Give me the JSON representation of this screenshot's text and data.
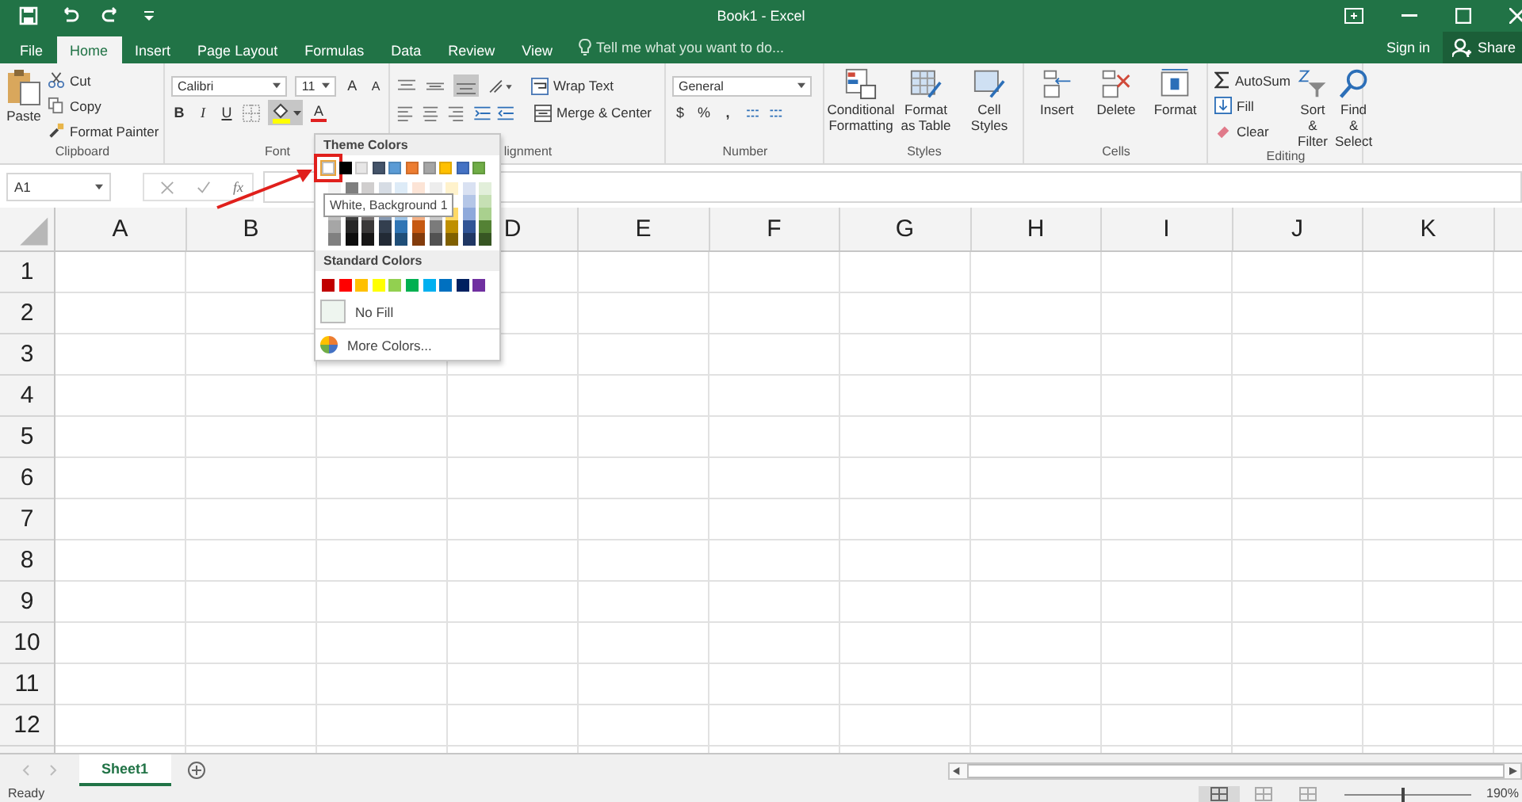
{
  "title_bar": {
    "title": "Book1 - Excel"
  },
  "tabs": [
    {
      "label": "File",
      "selected": false
    },
    {
      "label": "Home",
      "selected": true
    },
    {
      "label": "Insert",
      "selected": false
    },
    {
      "label": "Page Layout",
      "selected": false
    },
    {
      "label": "Formulas",
      "selected": false
    },
    {
      "label": "Data",
      "selected": false
    },
    {
      "label": "Review",
      "selected": false
    },
    {
      "label": "View",
      "selected": false
    }
  ],
  "tell_me": {
    "placeholder": "Tell me what you want to do..."
  },
  "account": {
    "sign_in": "Sign in",
    "share": "Share"
  },
  "ribbon": {
    "clipboard": {
      "label": "Clipboard",
      "paste": "Paste",
      "cut": "Cut",
      "copy": "Copy",
      "format_painter": "Format Painter"
    },
    "font": {
      "label": "Font",
      "font_name": "Calibri",
      "font_size": "11",
      "grow": "A",
      "shrink": "A",
      "bold": "B",
      "italic": "I",
      "underline": "U",
      "font_color": "A"
    },
    "alignment": {
      "label": "lignment",
      "wrap_text": "Wrap Text",
      "merge_center": "Merge & Center"
    },
    "number": {
      "label": "Number",
      "format": "General",
      "currency": "$",
      "percent": "%",
      "comma": ","
    },
    "styles": {
      "label": "Styles",
      "conditional_formatting": "Conditional Formatting",
      "format_as_table": "Format as Table",
      "cell_styles": "Cell Styles"
    },
    "cells": {
      "label": "Cells",
      "insert": "Insert",
      "delete": "Delete",
      "format": "Format"
    },
    "editing": {
      "label": "Editing",
      "autosum": "AutoSum",
      "fill": "Fill",
      "clear": "Clear",
      "sort_filter": "Sort & Filter",
      "find_select": "Find & Select"
    }
  },
  "formula_bar": {
    "name_box": "A1",
    "function_label": "fx"
  },
  "sheet": {
    "columns": [
      "A",
      "B",
      null,
      "D",
      "E",
      "F",
      "G",
      "H",
      "I",
      "J",
      "K"
    ],
    "rows": [
      "1",
      "2",
      "3",
      "4",
      "5",
      "6",
      "7",
      "8",
      "9",
      "10",
      "11",
      "12"
    ]
  },
  "fill_menu": {
    "theme_title": "Theme Colors",
    "theme_colors": [
      {
        "color": "#ffffff",
        "selected": true
      },
      {
        "color": "#000000",
        "selected": false
      },
      {
        "color": "#e7e6e6",
        "selected": false
      },
      {
        "color": "#44546a",
        "selected": false
      },
      {
        "color": "#5b9bd5",
        "selected": false
      },
      {
        "color": "#ed7d31",
        "selected": false
      },
      {
        "color": "#a5a5a5",
        "selected": false
      },
      {
        "color": "#ffc000",
        "selected": false
      },
      {
        "color": "#4472c4",
        "selected": false
      },
      {
        "color": "#70ad47",
        "selected": false
      }
    ],
    "shade_rows": [
      {
        "swatches": [
          {
            "color": "#f2f2f2"
          },
          {
            "color": "#7f7f7f"
          },
          {
            "color": "#d0cece"
          },
          {
            "color": "#d6dce4"
          },
          {
            "color": "#ddebf7"
          },
          {
            "color": "#fce4d6"
          },
          {
            "color": "#ededed"
          },
          {
            "color": "#fff2cc"
          },
          {
            "color": "#d9e1f2"
          },
          {
            "color": "#e2efda"
          }
        ]
      },
      {
        "swatches": [
          {
            "color": "#b4c6e7"
          },
          {
            "color": "#c6e0b4"
          }
        ]
      },
      {
        "swatches": [
          {
            "color": "#bfbfbf"
          },
          {
            "color": "#404040"
          },
          {
            "color": "#757171"
          },
          {
            "color": "#8497b0"
          },
          {
            "color": "#9bc2e6"
          },
          {
            "color": "#f4b084"
          },
          {
            "color": "#c9c9c9"
          },
          {
            "color": "#ffd966"
          },
          {
            "color": "#8ea9db"
          },
          {
            "color": "#a9d08e"
          }
        ]
      },
      {
        "swatches": [
          {
            "color": "#a6a6a6"
          },
          {
            "color": "#262626"
          },
          {
            "color": "#3a3838"
          },
          {
            "color": "#333f4f"
          },
          {
            "color": "#2f75b5"
          },
          {
            "color": "#c65911"
          },
          {
            "color": "#7b7b7b"
          },
          {
            "color": "#bf8f00"
          },
          {
            "color": "#305496"
          },
          {
            "color": "#548235"
          }
        ]
      },
      {
        "swatches": [
          {
            "color": "#808080"
          },
          {
            "color": "#0d0d0d"
          },
          {
            "color": "#171616"
          },
          {
            "color": "#222a35"
          },
          {
            "color": "#1f4e78"
          },
          {
            "color": "#833c0c"
          },
          {
            "color": "#525252"
          },
          {
            "color": "#806000"
          },
          {
            "color": "#203764"
          },
          {
            "color": "#375623"
          }
        ]
      }
    ],
    "tooltip": "White, Background 1",
    "standard_title": "Standard Colors",
    "standard_colors": [
      {
        "color": "#c00000"
      },
      {
        "color": "#ff0000"
      },
      {
        "color": "#ffc000"
      },
      {
        "color": "#ffff00"
      },
      {
        "color": "#92d050"
      },
      {
        "color": "#00b050"
      },
      {
        "color": "#00b0f0"
      },
      {
        "color": "#0070c0"
      },
      {
        "color": "#002060"
      },
      {
        "color": "#7030a0"
      }
    ],
    "no_fill": "No Fill",
    "more_colors": "More Colors..."
  },
  "sheet_tabs": [
    {
      "label": "Sheet1",
      "selected": true
    }
  ],
  "status_bar": {
    "status": "Ready",
    "views": [
      {
        "selected": true
      },
      {
        "selected": false
      },
      {
        "selected": false
      }
    ],
    "zoom_slider": {
      "level": 0.45
    },
    "zoom": "190%"
  }
}
